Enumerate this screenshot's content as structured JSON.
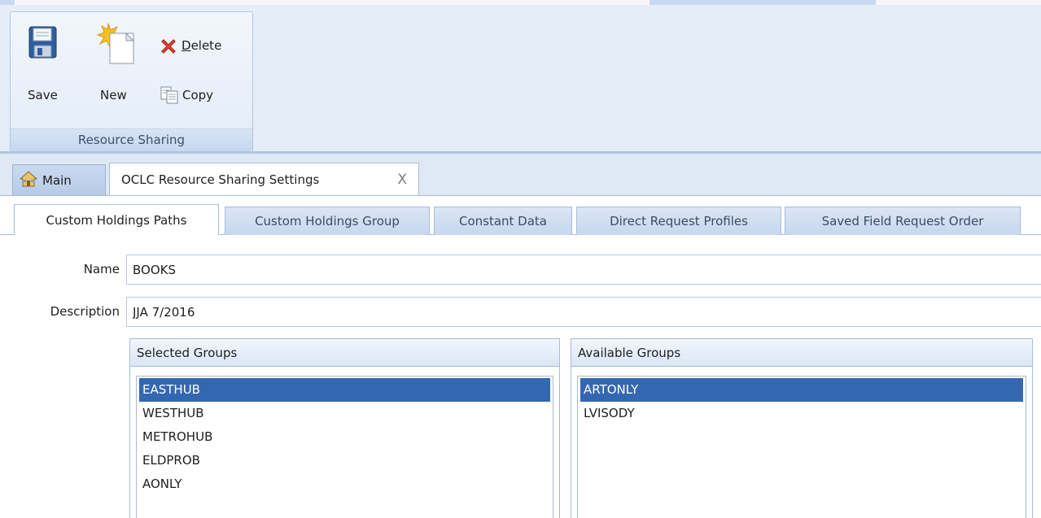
{
  "ribbon": {
    "group_label": "Resource Sharing",
    "buttons": {
      "save": "Save",
      "new": "New",
      "delete": "Delete",
      "copy": "Copy"
    },
    "icons": {
      "save": "floppy-disk-icon",
      "new": "new-document-icon",
      "delete": "delete-x-icon",
      "copy": "copy-document-icon"
    }
  },
  "doc_tabs": {
    "main": "Main",
    "active": "OCLC Resource Sharing Settings",
    "close_glyph": "X"
  },
  "subtabs": [
    "Custom Holdings Paths",
    "Custom Holdings Group",
    "Constant Data",
    "Direct Request Profiles",
    "Saved Field Request Order"
  ],
  "form": {
    "name_label": "Name",
    "name_value": "BOOKS",
    "description_label": "Description",
    "description_value": "JJA 7/2016"
  },
  "selected_groups": {
    "title": "Selected Groups",
    "items": [
      "EASTHUB",
      "WESTHUB",
      "METROHUB",
      "ELDPROB",
      "AONLY"
    ],
    "selected_item": "EASTHUB"
  },
  "available_groups": {
    "title": "Available Groups",
    "items": [
      "ARTONLY",
      "LVISODY"
    ],
    "selected_item": "ARTONLY"
  },
  "colors": {
    "selection": "#3467b1",
    "ribbon_bg": "#e4edf8",
    "delete_red": "#d63a2b"
  }
}
